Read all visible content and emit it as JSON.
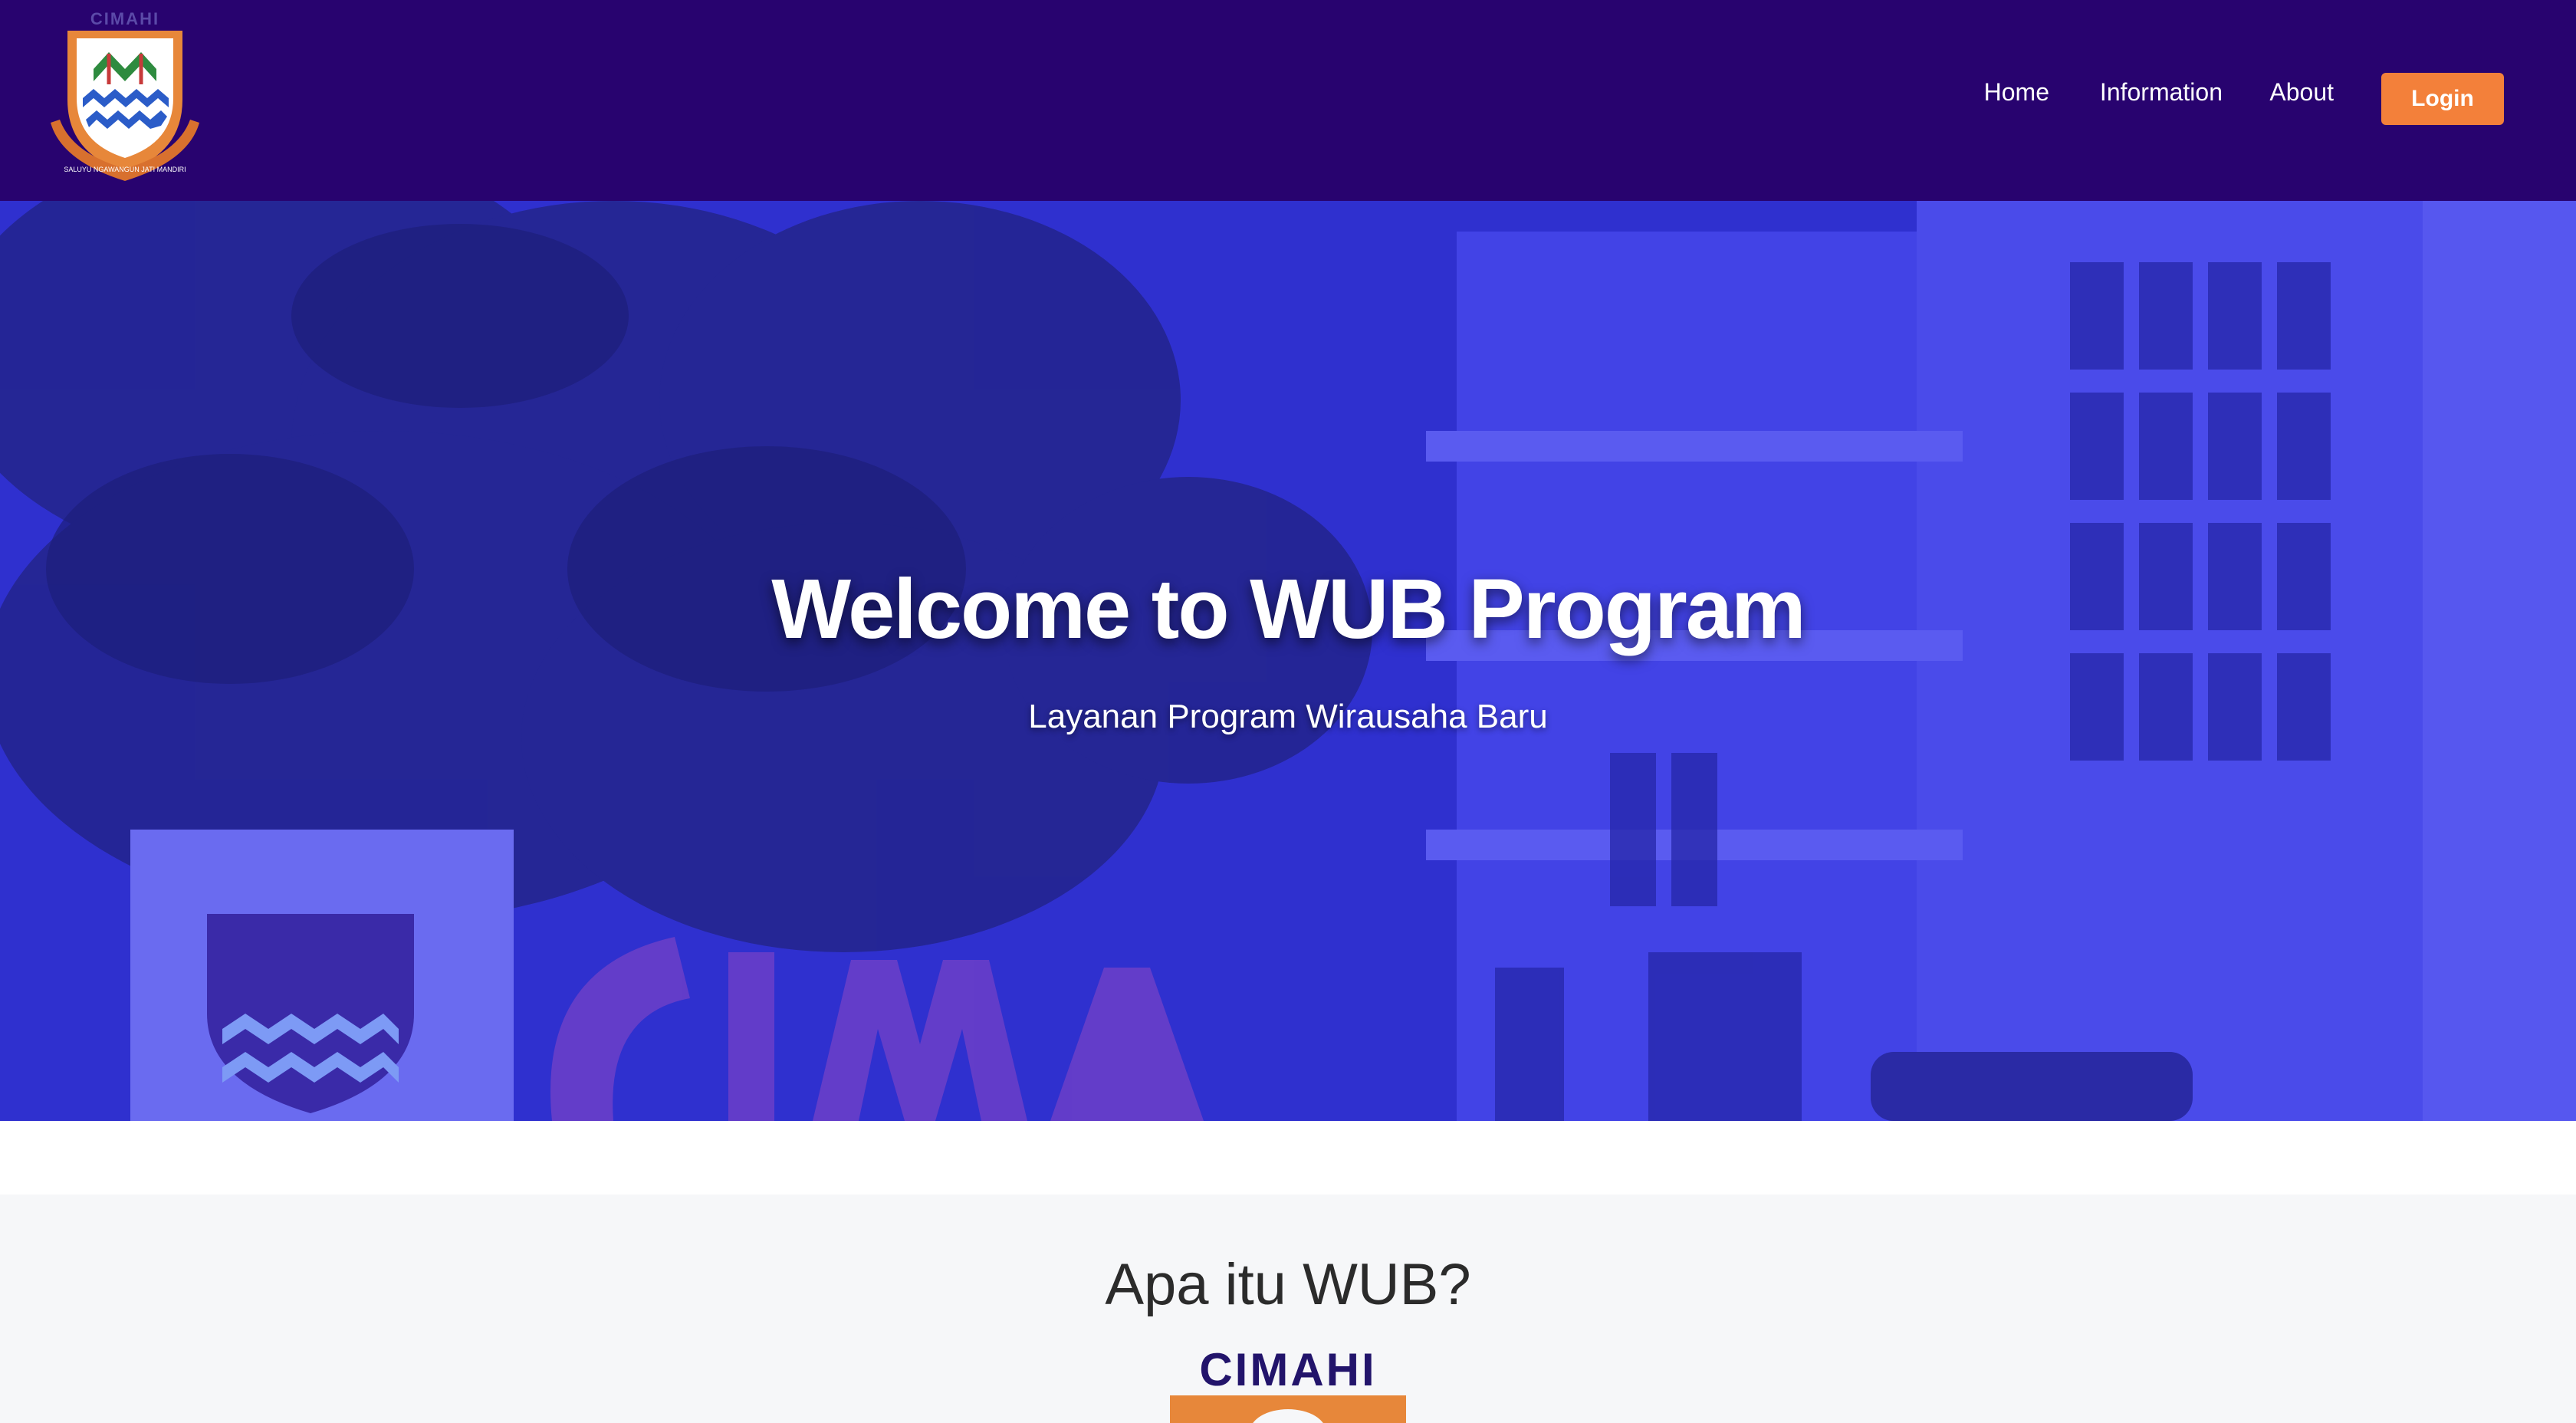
{
  "header": {
    "logo_name": "cimahi-city-emblem",
    "logo_top_text": "CIMAHI",
    "logo_ribbon_text": "SALUYU NGAWANGUN JATI MANDIRI",
    "nav": [
      {
        "label": "Home"
      },
      {
        "label": "Information"
      },
      {
        "label": "About"
      }
    ],
    "login_label": "Login"
  },
  "hero": {
    "title": "Welcome to WUB Program",
    "subtitle": "Layanan Program Wirausaha Baru"
  },
  "about": {
    "heading": "Apa itu WUB?",
    "logo_text": "CIMAHI"
  },
  "colors": {
    "navbar_bg": "#28036f",
    "hero_overlay": "#2f2fd0",
    "login_button": "#f3803a",
    "section_bg": "#f6f7f9",
    "heading_text": "#2b2b2b"
  }
}
